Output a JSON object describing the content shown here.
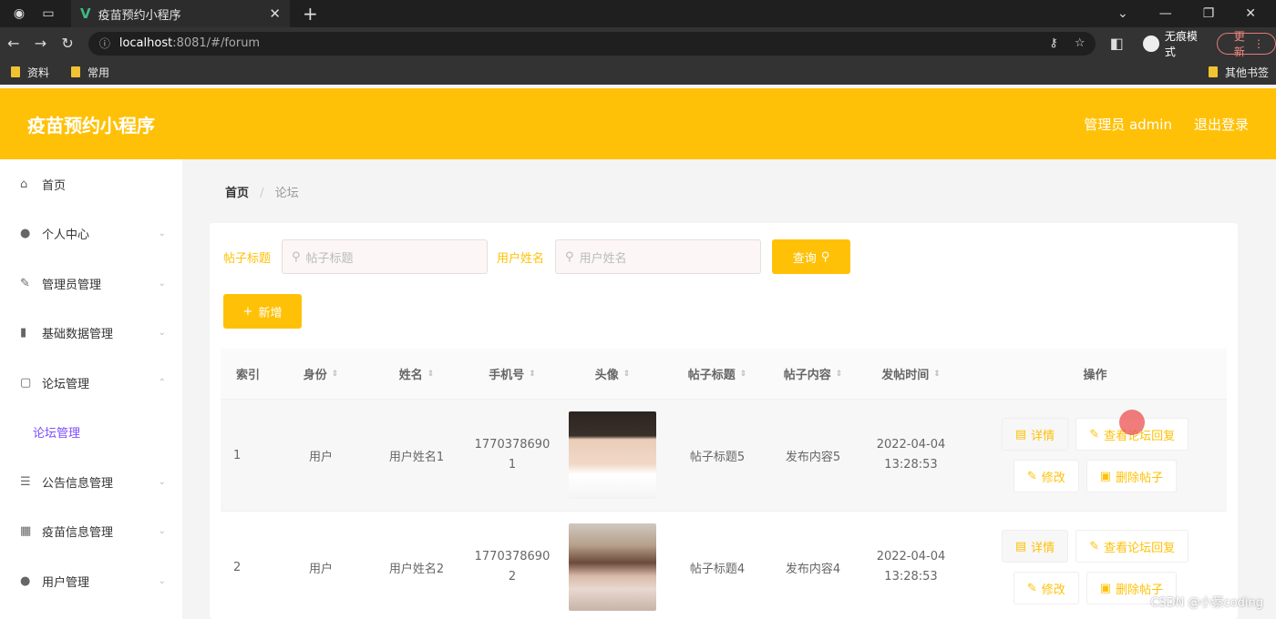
{
  "browser": {
    "tab_title": "疫苗预约小程序",
    "url_host": "localhost",
    "url_rest": ":8081/#/forum",
    "incognito_label": "无痕模式",
    "update_label": "更新",
    "bookmarks": [
      "资料",
      "常用"
    ],
    "other_bookmarks": "其他书签"
  },
  "header": {
    "title": "疫苗预约小程序",
    "admin_label": "管理员 admin",
    "logout_label": "退出登录"
  },
  "sidebar": {
    "items": [
      {
        "label": "首页",
        "icon": "home-icon"
      },
      {
        "label": "个人中心",
        "icon": "user-icon"
      },
      {
        "label": "管理员管理",
        "icon": "edit-icon"
      },
      {
        "label": "基础数据管理",
        "icon": "bar-chart-icon"
      },
      {
        "label": "论坛管理",
        "icon": "square-icon"
      },
      {
        "label": "论坛管理",
        "icon": ""
      },
      {
        "label": "公告信息管理",
        "icon": "list-icon"
      },
      {
        "label": "疫苗信息管理",
        "icon": "grid-icon"
      },
      {
        "label": "用户管理",
        "icon": "user-icon"
      }
    ]
  },
  "breadcrumb": {
    "home": "首页",
    "current": "论坛"
  },
  "search": {
    "title_label": "帖子标题",
    "title_placeholder": "帖子标题",
    "name_label": "用户姓名",
    "name_placeholder": "用户姓名",
    "query_label": "查询"
  },
  "add_label": "新增",
  "table": {
    "headers": [
      "索引",
      "身份",
      "姓名",
      "手机号",
      "头像",
      "帖子标题",
      "帖子内容",
      "发帖时间",
      "操作"
    ],
    "rows": [
      {
        "index": "1",
        "role": "用户",
        "name": "用户姓名1",
        "phone_a": "1770378690",
        "phone_b": "1",
        "title": "帖子标题5",
        "content": "发布内容5",
        "date": "2022-04-04",
        "time": "13:28:53"
      },
      {
        "index": "2",
        "role": "用户",
        "name": "用户姓名2",
        "phone_a": "1770378690",
        "phone_b": "2",
        "title": "帖子标题4",
        "content": "发布内容4",
        "date": "2022-04-04",
        "time": "13:28:53"
      }
    ],
    "ops": {
      "detail": "详情",
      "view_replies": "查看论坛回复",
      "edit": "修改",
      "delete": "删除帖子"
    }
  },
  "watermark": "CSDN @小蔡coding",
  "colors": {
    "accent": "#ffc107",
    "submenu_active": "#7c4dff"
  }
}
